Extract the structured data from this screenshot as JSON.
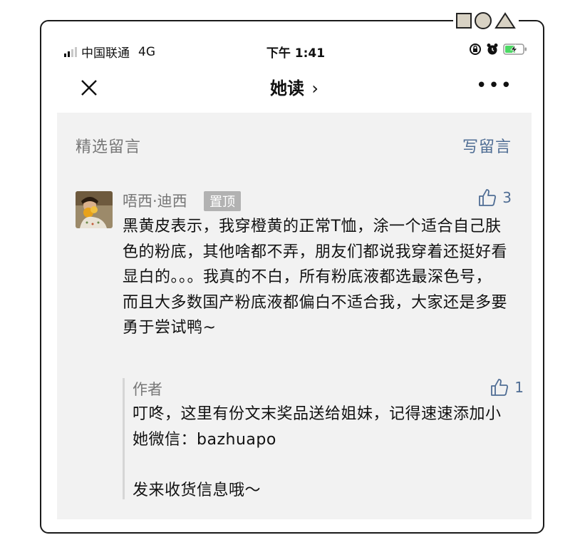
{
  "status_bar": {
    "carrier": "中国联通",
    "network": "4G",
    "time": "下午 1:41"
  },
  "nav": {
    "title": "她读",
    "chevron": "›"
  },
  "comments": {
    "section_title": "精选留言",
    "write_label": "写留言",
    "items": [
      {
        "author": "唔西·迪西",
        "badge": "置顶",
        "likes": "3",
        "text": "黑黄皮表示，我穿橙黄的正常T恤，涂一个适合自己肤色的粉底，其他啥都不弄，朋友们都说我穿着还挺好看显白的。。。我真的不白，所有粉底液都选最深色号，而且大多数国产粉底液都偏白不适合我，大家还是多要勇于尝试鸭~",
        "reply": {
          "author": "作者",
          "likes": "1",
          "text": "叮咚，这里有份文末奖品送给姐妹，记得速速添加小她微信：bazhuapo\n\n发来收货信息哦～"
        }
      }
    ]
  },
  "icons": [
    "signal-icon",
    "alarm-lock-icon",
    "alarm-icon",
    "battery-charging-icon",
    "close-icon",
    "more-icon",
    "thumbs-up-icon",
    "square-icon",
    "circle-icon",
    "triangle-icon"
  ],
  "colors": {
    "link": "#4f6d94",
    "panel": "#f2f2f2",
    "muted": "#777777",
    "battery": "#4cd964"
  }
}
